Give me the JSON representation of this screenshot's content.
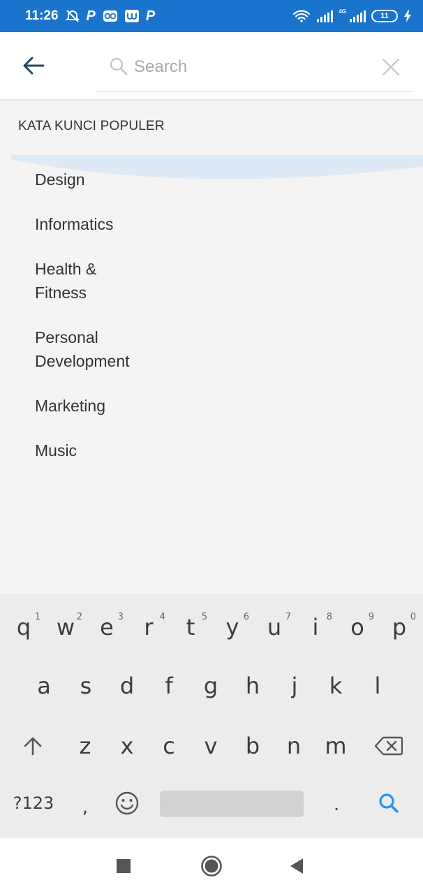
{
  "status_bar": {
    "time": "11:26",
    "battery": "11",
    "network": "4G",
    "left_icons": [
      "alarm-off-icon",
      "p-app-icon",
      "owl-icon",
      "shopee-icon",
      "p-app-icon"
    ],
    "background": "#1a73cc"
  },
  "search": {
    "placeholder": "Search",
    "value": ""
  },
  "section": {
    "title": "KATA KUNCI POPULER"
  },
  "keywords": [
    "Design",
    "Informatics",
    "Health &\nFitness",
    "Personal\nDevelopment",
    "Marketing",
    "Music"
  ],
  "keyboard": {
    "row1": [
      {
        "key": "q",
        "hint": "1"
      },
      {
        "key": "w",
        "hint": "2"
      },
      {
        "key": "e",
        "hint": "3"
      },
      {
        "key": "r",
        "hint": "4"
      },
      {
        "key": "t",
        "hint": "5"
      },
      {
        "key": "y",
        "hint": "6"
      },
      {
        "key": "u",
        "hint": "7"
      },
      {
        "key": "i",
        "hint": "8"
      },
      {
        "key": "o",
        "hint": "9"
      },
      {
        "key": "p",
        "hint": "0"
      }
    ],
    "row2": [
      "a",
      "s",
      "d",
      "f",
      "g",
      "h",
      "j",
      "k",
      "l"
    ],
    "row3": [
      "z",
      "x",
      "c",
      "v",
      "b",
      "n",
      "m"
    ],
    "symbols_label": "?123",
    "comma": ",",
    "period": ".",
    "accent_color": "#2196f3"
  }
}
